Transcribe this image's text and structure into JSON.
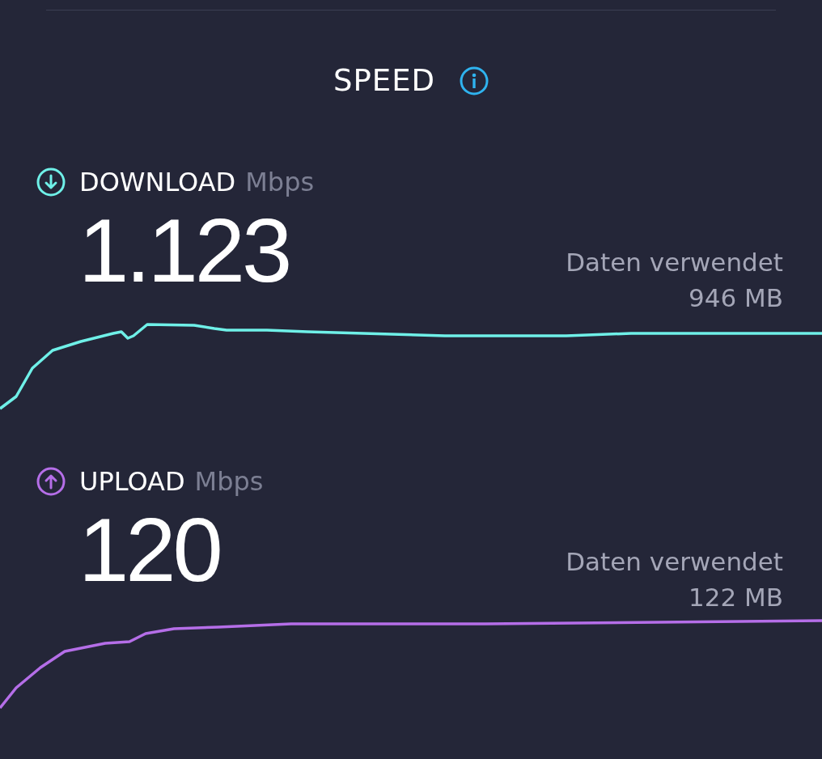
{
  "title": "SPEED",
  "metrics": [
    {
      "kind": "download",
      "label": "DOWNLOAD",
      "unit": "Mbps",
      "value": "1.123",
      "data_label": "Daten verwendet",
      "data_amount": "946 MB",
      "color": "#6ff0e8"
    },
    {
      "kind": "upload",
      "label": "UPLOAD",
      "unit": "Mbps",
      "value": "120",
      "data_label": "Daten verwendet",
      "data_amount": "122 MB",
      "color": "#b56ee8"
    }
  ]
}
